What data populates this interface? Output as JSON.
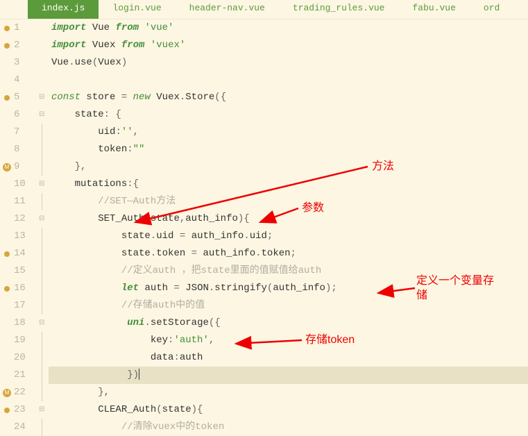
{
  "tabs": {
    "items": [
      {
        "label": "index.js",
        "active": true
      },
      {
        "label": "login.vue",
        "active": false
      },
      {
        "label": "header-nav.vue",
        "active": false
      },
      {
        "label": "trading_rules.vue",
        "active": false
      },
      {
        "label": "fabu.vue",
        "active": false
      },
      {
        "label": "ord",
        "active": false
      }
    ]
  },
  "annotations": {
    "method": "方法",
    "param": "参数",
    "define_var": "定义一个变量存储",
    "store_token": "存储token"
  },
  "code": {
    "lines": [
      {
        "n": 1,
        "bp": "dot",
        "fold": "",
        "tokens": [
          {
            "c": "kw2",
            "t": "import"
          },
          {
            "c": "id",
            "t": " Vue "
          },
          {
            "c": "kw2",
            "t": "from"
          },
          {
            "c": "id",
            "t": " "
          },
          {
            "c": "str",
            "t": "'vue'"
          }
        ]
      },
      {
        "n": 2,
        "bp": "dot",
        "fold": "",
        "tokens": [
          {
            "c": "kw2",
            "t": "import"
          },
          {
            "c": "id",
            "t": " Vuex "
          },
          {
            "c": "kw2",
            "t": "from"
          },
          {
            "c": "id",
            "t": " "
          },
          {
            "c": "str",
            "t": "'vuex'"
          }
        ]
      },
      {
        "n": 3,
        "bp": "",
        "fold": "",
        "tokens": [
          {
            "c": "id",
            "t": "Vue"
          },
          {
            "c": "op",
            "t": "."
          },
          {
            "c": "id",
            "t": "use"
          },
          {
            "c": "op",
            "t": "("
          },
          {
            "c": "id",
            "t": "Vuex"
          },
          {
            "c": "op",
            "t": ")"
          }
        ]
      },
      {
        "n": 4,
        "bp": "",
        "fold": "",
        "tokens": []
      },
      {
        "n": 5,
        "bp": "dot",
        "fold": "⊟",
        "tokens": [
          {
            "c": "kw",
            "t": "const"
          },
          {
            "c": "id",
            "t": " store "
          },
          {
            "c": "op",
            "t": "= "
          },
          {
            "c": "kw",
            "t": "new"
          },
          {
            "c": "id",
            "t": " Vuex"
          },
          {
            "c": "op",
            "t": "."
          },
          {
            "c": "id",
            "t": "Store"
          },
          {
            "c": "op",
            "t": "({"
          }
        ]
      },
      {
        "n": 6,
        "bp": "",
        "fold": "⊟",
        "indent": 1,
        "tokens": [
          {
            "c": "id",
            "t": "state"
          },
          {
            "c": "op",
            "t": ": {"
          }
        ]
      },
      {
        "n": 7,
        "bp": "",
        "fold": "|",
        "indent": 2,
        "tokens": [
          {
            "c": "id",
            "t": "uid"
          },
          {
            "c": "op",
            "t": ":"
          },
          {
            "c": "str",
            "t": "''"
          },
          {
            "c": "op",
            "t": ","
          }
        ]
      },
      {
        "n": 8,
        "bp": "",
        "fold": "|",
        "indent": 2,
        "tokens": [
          {
            "c": "id",
            "t": "token"
          },
          {
            "c": "op",
            "t": ":"
          },
          {
            "c": "str",
            "t": "\"\""
          }
        ]
      },
      {
        "n": 9,
        "bp": "M",
        "fold": "|",
        "indent": 1,
        "tokens": [
          {
            "c": "op",
            "t": "},"
          }
        ]
      },
      {
        "n": 10,
        "bp": "",
        "fold": "⊟",
        "indent": 1,
        "tokens": [
          {
            "c": "id",
            "t": "mutations"
          },
          {
            "c": "op",
            "t": ":{"
          }
        ]
      },
      {
        "n": 11,
        "bp": "",
        "fold": "|",
        "indent": 2,
        "tokens": [
          {
            "c": "com",
            "t": "//SET—Auth方法"
          }
        ]
      },
      {
        "n": 12,
        "bp": "",
        "fold": "⊟",
        "indent": 2,
        "tokens": [
          {
            "c": "id",
            "t": "SET_Auth"
          },
          {
            "c": "op",
            "t": "("
          },
          {
            "c": "id",
            "t": "state"
          },
          {
            "c": "op",
            "t": ","
          },
          {
            "c": "id",
            "t": "auth_info"
          },
          {
            "c": "op",
            "t": "){"
          }
        ]
      },
      {
        "n": 13,
        "bp": "",
        "fold": "|",
        "indent": 3,
        "tokens": [
          {
            "c": "id",
            "t": "state"
          },
          {
            "c": "op",
            "t": "."
          },
          {
            "c": "id",
            "t": "uid"
          },
          {
            "c": "op",
            "t": " = "
          },
          {
            "c": "id",
            "t": "auth_info"
          },
          {
            "c": "op",
            "t": "."
          },
          {
            "c": "id",
            "t": "uid"
          },
          {
            "c": "op",
            "t": ";"
          }
        ]
      },
      {
        "n": 14,
        "bp": "dot",
        "fold": "|",
        "indent": 3,
        "tokens": [
          {
            "c": "id",
            "t": "state"
          },
          {
            "c": "op",
            "t": "."
          },
          {
            "c": "id",
            "t": "token"
          },
          {
            "c": "op",
            "t": " = "
          },
          {
            "c": "id",
            "t": "auth_info"
          },
          {
            "c": "op",
            "t": "."
          },
          {
            "c": "id",
            "t": "token"
          },
          {
            "c": "op",
            "t": ";"
          }
        ]
      },
      {
        "n": 15,
        "bp": "",
        "fold": "|",
        "indent": 3,
        "tokens": [
          {
            "c": "com",
            "t": "//定义auth ，把state里面的值赋值给auth"
          }
        ]
      },
      {
        "n": 16,
        "bp": "dot",
        "fold": "|",
        "indent": 3,
        "tokens": [
          {
            "c": "kw2",
            "t": "let"
          },
          {
            "c": "id",
            "t": " auth "
          },
          {
            "c": "op",
            "t": "= "
          },
          {
            "c": "id",
            "t": "JSON"
          },
          {
            "c": "op",
            "t": "."
          },
          {
            "c": "id",
            "t": "stringify"
          },
          {
            "c": "op",
            "t": "("
          },
          {
            "c": "id",
            "t": "auth_info"
          },
          {
            "c": "op",
            "t": ");"
          }
        ]
      },
      {
        "n": 17,
        "bp": "",
        "fold": "|",
        "indent": 3,
        "tokens": [
          {
            "c": "com",
            "t": "//存储auth中的值"
          }
        ]
      },
      {
        "n": 18,
        "bp": "",
        "fold": "⊟",
        "indent": 3,
        "tokens": [
          {
            "c": "id",
            "t": " "
          },
          {
            "c": "kw2",
            "t": "uni"
          },
          {
            "c": "op",
            "t": "."
          },
          {
            "c": "id",
            "t": "setStorage"
          },
          {
            "c": "op",
            "t": "({"
          }
        ]
      },
      {
        "n": 19,
        "bp": "",
        "fold": "|",
        "indent": 4,
        "tokens": [
          {
            "c": "id",
            "t": " key"
          },
          {
            "c": "op",
            "t": ":"
          },
          {
            "c": "str",
            "t": "'auth'"
          },
          {
            "c": "op",
            "t": ","
          }
        ]
      },
      {
        "n": 20,
        "bp": "",
        "fold": "|",
        "indent": 4,
        "tokens": [
          {
            "c": "id",
            "t": " data"
          },
          {
            "c": "op",
            "t": ":"
          },
          {
            "c": "id",
            "t": "auth"
          }
        ]
      },
      {
        "n": 21,
        "bp": "",
        "fold": "|",
        "indent": 3,
        "tokens": [
          {
            "c": "op",
            "t": " })"
          }
        ],
        "highlight": true,
        "cursor": true
      },
      {
        "n": 22,
        "bp": "M",
        "fold": "|",
        "indent": 2,
        "tokens": [
          {
            "c": "op",
            "t": "},"
          }
        ]
      },
      {
        "n": 23,
        "bp": "dot",
        "fold": "⊟",
        "indent": 2,
        "tokens": [
          {
            "c": "id",
            "t": "CLEAR_Auth"
          },
          {
            "c": "op",
            "t": "("
          },
          {
            "c": "id",
            "t": "state"
          },
          {
            "c": "op",
            "t": "){"
          }
        ]
      },
      {
        "n": 24,
        "bp": "",
        "fold": "|",
        "indent": 3,
        "tokens": [
          {
            "c": "com",
            "t": "//清除vuex中的token"
          }
        ]
      }
    ]
  }
}
